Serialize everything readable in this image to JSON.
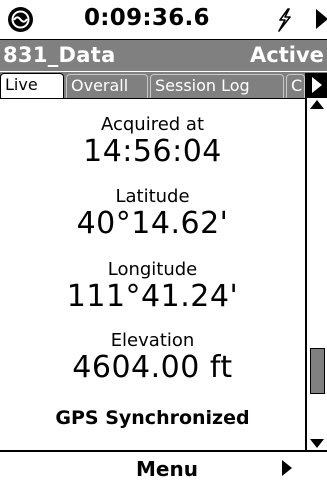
{
  "status": {
    "time": "0:09:36.6",
    "logo_icon": "device-logo-icon",
    "power_icon": "power-plug-icon",
    "next_icon": "play-arrow-icon"
  },
  "title": {
    "left": "831_Data",
    "right": "Active"
  },
  "tabs": [
    {
      "label": "Live",
      "active": true
    },
    {
      "label": "Overall",
      "active": false
    },
    {
      "label": "Session Log",
      "active": false
    },
    {
      "label": "C",
      "active": false
    }
  ],
  "live": {
    "acquired_label": "Acquired at",
    "acquired_value": "14:56:04",
    "latitude_label": "Latitude",
    "latitude_value": "40°14.62'",
    "longitude_label": "Longitude",
    "longitude_value": "111°41.24'",
    "elevation_label": "Elevation",
    "elevation_value": "4604.00 ft",
    "sync_status": "GPS Synchronized"
  },
  "menu": {
    "label": "Menu"
  },
  "colors": {
    "header_gray": "#808080",
    "text": "#000000",
    "background": "#ffffff"
  }
}
